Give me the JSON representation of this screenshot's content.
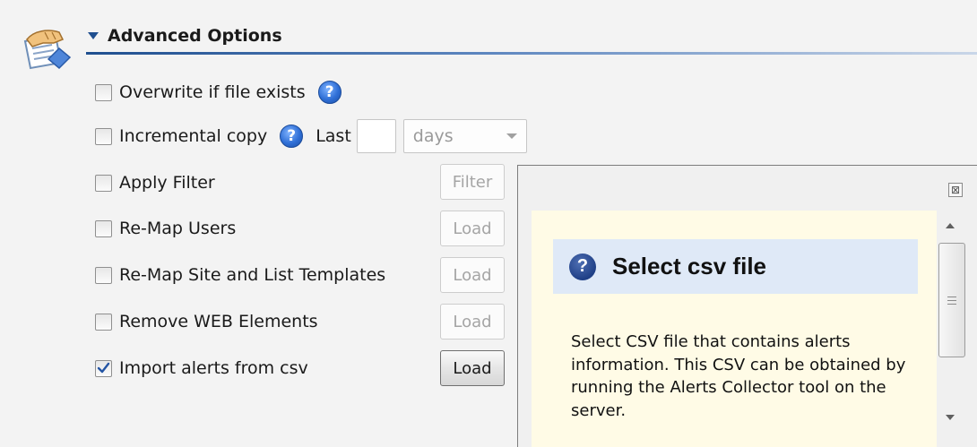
{
  "section": {
    "title": "Advanced Options",
    "icon": "hand-document-icon"
  },
  "options": [
    {
      "label": "Overwrite if file exists",
      "checked": false,
      "help": true
    },
    {
      "label": "Incremental copy",
      "checked": false,
      "help": true
    },
    {
      "label": "Apply Filter",
      "checked": false,
      "button": "Filter",
      "button_enabled": false
    },
    {
      "label": "Re-Map Users",
      "checked": false,
      "button": "Load",
      "button_enabled": false
    },
    {
      "label": "Re-Map Site and List Templates",
      "checked": false,
      "button": "Load",
      "button_enabled": false
    },
    {
      "label": "Remove WEB Elements",
      "checked": false,
      "button": "Load",
      "button_enabled": false
    },
    {
      "label": "Import alerts from csv",
      "checked": true,
      "button": "Load",
      "button_enabled": true
    }
  ],
  "incremental": {
    "last_label": "Last",
    "last_value": "",
    "unit_selected": "days"
  },
  "tooltip": {
    "close_glyph": "⊠",
    "title": "Select csv file",
    "body": "Select CSV file that contains alerts information. This CSV can be obtained by running the Alerts Collector tool on the server."
  },
  "colors": {
    "accent": "#1f4f8f",
    "help_blue": "#2f6fd6",
    "tooltip_bg": "#fffbe6",
    "tooltip_header_bg": "#dfe9f7"
  }
}
